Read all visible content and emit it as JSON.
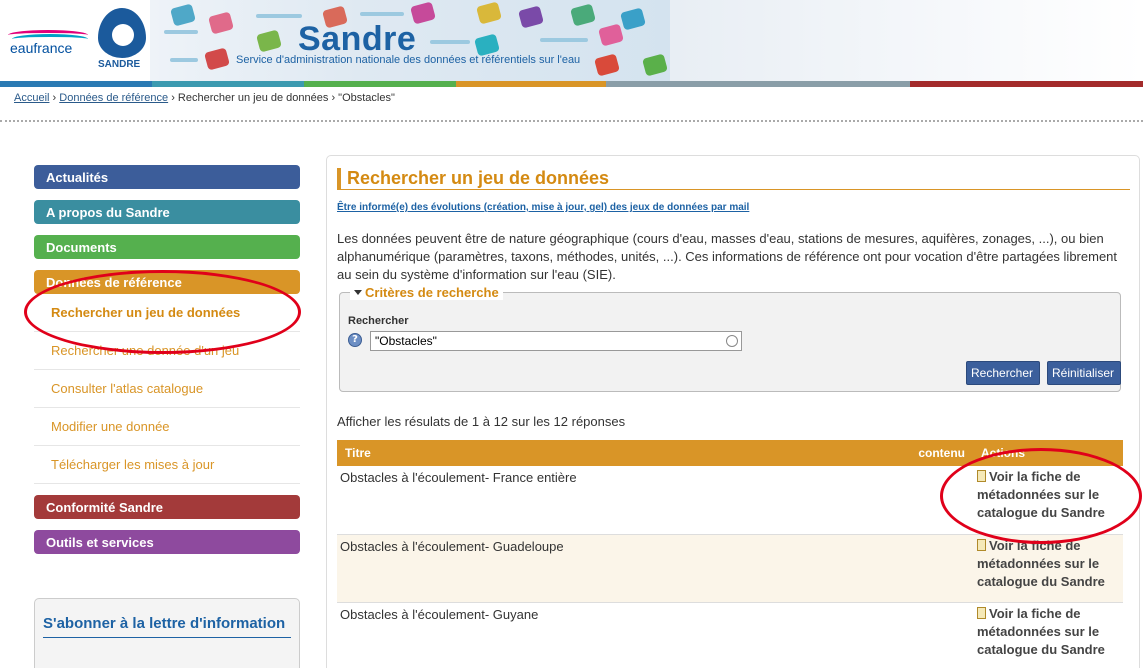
{
  "header": {
    "logo_eaufrance": "eaufrance",
    "logo_sandre": "SANDRE",
    "site_title": "Sandre",
    "site_subtitle": "Service d'administration nationale des données et référentiels sur l'eau",
    "color_bar": [
      "#2a7ab3",
      "#3c9ab0",
      "#55b04e",
      "#d99527",
      "#8a9ea8",
      "#a32b2b"
    ]
  },
  "breadcrumb": {
    "items": [
      "Accueil",
      "Données de référence",
      "Rechercher un jeu de données",
      "\"Obstacles\""
    ],
    "separator": "›"
  },
  "sidebar": {
    "menu": [
      {
        "label": "Actualités",
        "color": "#3c5d9a"
      },
      {
        "label": "A propos du Sandre",
        "color": "#3a8ea0"
      },
      {
        "label": "Documents",
        "color": "#55b04e"
      },
      {
        "label": "Données de référence",
        "color": "#d99527"
      }
    ],
    "submenu": [
      "Rechercher un jeu de données",
      "Rechercher une donnée d'un jeu",
      "Consulter l'atlas catalogue",
      "Modifier une donnée",
      "Télécharger les mises à jour"
    ],
    "menu_after": [
      {
        "label": "Conformité Sandre",
        "color": "#a33a3a"
      },
      {
        "label": "Outils et services",
        "color": "#8e4a9e"
      }
    ],
    "newsletter_title": "S'abonner à la lettre d'information"
  },
  "main": {
    "title": "Rechercher un jeu de données",
    "info_link": "Être informé(e) des évolutions (création, mise à jour, gel) des jeux de données par mail",
    "description": "Les données peuvent être de nature géographique (cours d'eau, masses d'eau, stations de mesures, aquifères, zonages, ...), ou bien alphanumérique (paramètres, taxons, méthodes, unités, ...). Ces informations de référence ont pour vocation d'être partagées librement au sein du système d'information sur l'eau (SIE).",
    "criteria": {
      "legend": "Critères de recherche",
      "label": "Rechercher",
      "help_icon": "?",
      "input_value": "\"Obstacles\"",
      "search_button": "Rechercher",
      "reset_button": "Réinitialiser"
    },
    "results_summary": "Afficher les résulats de 1 à 12 sur les 12 réponses",
    "table": {
      "headers": {
        "title": "Titre",
        "content": "contenu",
        "actions": "Actions"
      },
      "rows": [
        {
          "title": "Obstacles à l'écoulement- France entière",
          "action": "Voir la fiche de métadonnées sur le catalogue du Sandre"
        },
        {
          "title": "Obstacles à l'écoulement- Guadeloupe",
          "action": "Voir la fiche de métadonnées sur le catalogue du Sandre"
        },
        {
          "title": "Obstacles à l'écoulement- Guyane",
          "action": "Voir la fiche de métadonnées sur le catalogue du Sandre"
        }
      ]
    }
  },
  "annotation_color": "#e0001a"
}
